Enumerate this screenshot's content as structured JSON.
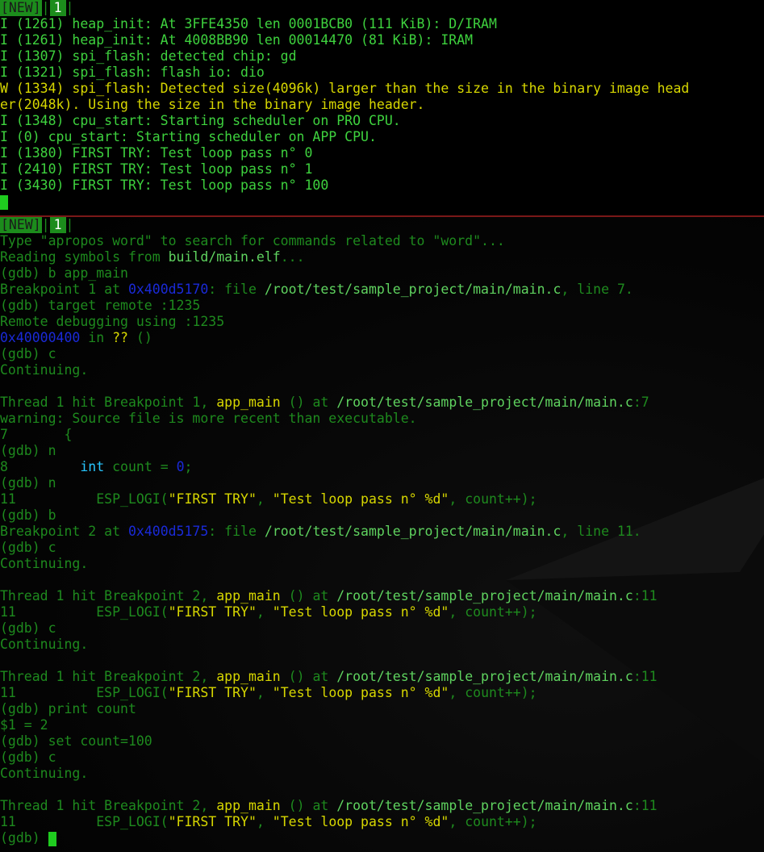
{
  "panes": [
    {
      "tabs": {
        "new_label": "[NEW]",
        "sep1": "|",
        "num_label": "1",
        "sep2": "|"
      },
      "lines": [
        [
          {
            "t": "I (1261) heap_init: At 3FFE4350 len 0001BCB0 (111 KiB): D/IRAM",
            "c": "c-g"
          }
        ],
        [
          {
            "t": "I (1261) heap_init: At 4008BB90 len 00014470 (81 KiB): IRAM",
            "c": "c-g"
          }
        ],
        [
          {
            "t": "I (1307) spi_flash: detected chip: gd",
            "c": "c-g"
          }
        ],
        [
          {
            "t": "I (1321) spi_flash: flash io: dio",
            "c": "c-g"
          }
        ],
        [
          {
            "t": "W (1334) spi_flash: Detected size(4096k) larger than the size in the binary image head",
            "c": "c-y"
          }
        ],
        [
          {
            "t": "er(2048k). Using the size in the binary image header.",
            "c": "c-y"
          }
        ],
        [
          {
            "t": "I (1348) cpu_start: Starting scheduler on PRO CPU.",
            "c": "c-g"
          }
        ],
        [
          {
            "t": "I (0) cpu_start: Starting scheduler on APP CPU.",
            "c": "c-g"
          }
        ],
        [
          {
            "t": "I (1380) FIRST TRY: Test loop pass n° 0",
            "c": "c-g"
          }
        ],
        [
          {
            "t": "I (2410) FIRST TRY: Test loop pass n° 1",
            "c": "c-g"
          }
        ],
        [
          {
            "t": "I (3430) FIRST TRY: Test loop pass n° 100",
            "c": "c-g"
          }
        ],
        [
          {
            "cursor": true
          }
        ]
      ]
    },
    {
      "tabs": {
        "new_label": "[NEW]",
        "sep1": "|",
        "num_label": "1",
        "sep2": "|"
      },
      "lines": [
        [
          {
            "t": "Type \"apropos word\" to search for commands related to \"word\"...",
            "c": "c-dg"
          }
        ],
        [
          {
            "t": "Reading symbols from ",
            "c": "c-dg"
          },
          {
            "t": "build/main.elf",
            "c": "c-ok"
          },
          {
            "t": "...",
            "c": "c-dg"
          }
        ],
        [
          {
            "t": "(gdb) b app_main",
            "c": "c-dg"
          }
        ],
        [
          {
            "t": "Breakpoint 1 at ",
            "c": "c-dg"
          },
          {
            "t": "0x400d5170",
            "c": "c-b"
          },
          {
            "t": ": file ",
            "c": "c-dg"
          },
          {
            "t": "/root/test/sample_project/main/main.c",
            "c": "c-ok"
          },
          {
            "t": ", line 7.",
            "c": "c-dg"
          }
        ],
        [
          {
            "t": "(gdb) target remote :1235",
            "c": "c-dg"
          }
        ],
        [
          {
            "t": "Remote debugging using :1235",
            "c": "c-dg"
          }
        ],
        [
          {
            "t": "0x40000400",
            "c": "c-b"
          },
          {
            "t": " in ",
            "c": "c-dg"
          },
          {
            "t": "??",
            "c": "c-y"
          },
          {
            "t": " ()",
            "c": "c-dg"
          }
        ],
        [
          {
            "t": "(gdb) c",
            "c": "c-dg"
          }
        ],
        [
          {
            "t": "Continuing.",
            "c": "c-dg"
          }
        ],
        [
          {
            "t": "",
            "c": "c-dg"
          }
        ],
        [
          {
            "t": "Thread 1 hit Breakpoint 1, ",
            "c": "c-dg"
          },
          {
            "t": "app_main",
            "c": "c-y"
          },
          {
            "t": " () at ",
            "c": "c-dg"
          },
          {
            "t": "/root/test/sample_project/main/main.c",
            "c": "c-ok"
          },
          {
            "t": ":7",
            "c": "c-dg"
          }
        ],
        [
          {
            "t": "warning: Source file is more recent than executable.",
            "c": "c-dg"
          }
        ],
        [
          {
            "t": "7       {",
            "c": "c-dg"
          }
        ],
        [
          {
            "t": "(gdb) n",
            "c": "c-dg"
          }
        ],
        [
          {
            "t": "8         ",
            "c": "c-dg"
          },
          {
            "t": "int",
            "c": "c-c"
          },
          {
            "t": " count = ",
            "c": "c-dg"
          },
          {
            "t": "0",
            "c": "c-b"
          },
          {
            "t": ";",
            "c": "c-dg"
          }
        ],
        [
          {
            "t": "(gdb) n",
            "c": "c-dg"
          }
        ],
        [
          {
            "t": "11          ESP_LOGI(",
            "c": "c-dg"
          },
          {
            "t": "\"FIRST TRY\"",
            "c": "c-y"
          },
          {
            "t": ", ",
            "c": "c-dg"
          },
          {
            "t": "\"Test loop pass n° %d\"",
            "c": "c-y"
          },
          {
            "t": ", count++);",
            "c": "c-dg"
          }
        ],
        [
          {
            "t": "(gdb) b",
            "c": "c-dg"
          }
        ],
        [
          {
            "t": "Breakpoint 2 at ",
            "c": "c-dg"
          },
          {
            "t": "0x400d5175",
            "c": "c-b"
          },
          {
            "t": ": file ",
            "c": "c-dg"
          },
          {
            "t": "/root/test/sample_project/main/main.c",
            "c": "c-ok"
          },
          {
            "t": ", line 11.",
            "c": "c-dg"
          }
        ],
        [
          {
            "t": "(gdb) c",
            "c": "c-dg"
          }
        ],
        [
          {
            "t": "Continuing.",
            "c": "c-dg"
          }
        ],
        [
          {
            "t": "",
            "c": "c-dg"
          }
        ],
        [
          {
            "t": "Thread 1 hit Breakpoint 2, ",
            "c": "c-dg"
          },
          {
            "t": "app_main",
            "c": "c-y"
          },
          {
            "t": " () at ",
            "c": "c-dg"
          },
          {
            "t": "/root/test/sample_project/main/main.c",
            "c": "c-ok"
          },
          {
            "t": ":11",
            "c": "c-dg"
          }
        ],
        [
          {
            "t": "11          ESP_LOGI(",
            "c": "c-dg"
          },
          {
            "t": "\"FIRST TRY\"",
            "c": "c-y"
          },
          {
            "t": ", ",
            "c": "c-dg"
          },
          {
            "t": "\"Test loop pass n° %d\"",
            "c": "c-y"
          },
          {
            "t": ", count++);",
            "c": "c-dg"
          }
        ],
        [
          {
            "t": "(gdb) c",
            "c": "c-dg"
          }
        ],
        [
          {
            "t": "Continuing.",
            "c": "c-dg"
          }
        ],
        [
          {
            "t": "",
            "c": "c-dg"
          }
        ],
        [
          {
            "t": "Thread 1 hit Breakpoint 2, ",
            "c": "c-dg"
          },
          {
            "t": "app_main",
            "c": "c-y"
          },
          {
            "t": " () at ",
            "c": "c-dg"
          },
          {
            "t": "/root/test/sample_project/main/main.c",
            "c": "c-ok"
          },
          {
            "t": ":11",
            "c": "c-dg"
          }
        ],
        [
          {
            "t": "11          ESP_LOGI(",
            "c": "c-dg"
          },
          {
            "t": "\"FIRST TRY\"",
            "c": "c-y"
          },
          {
            "t": ", ",
            "c": "c-dg"
          },
          {
            "t": "\"Test loop pass n° %d\"",
            "c": "c-y"
          },
          {
            "t": ", count++);",
            "c": "c-dg"
          }
        ],
        [
          {
            "t": "(gdb) print count",
            "c": "c-dg"
          }
        ],
        [
          {
            "t": "$1 = 2",
            "c": "c-dg"
          }
        ],
        [
          {
            "t": "(gdb) set count=100",
            "c": "c-dg"
          }
        ],
        [
          {
            "t": "(gdb) c",
            "c": "c-dg"
          }
        ],
        [
          {
            "t": "Continuing.",
            "c": "c-dg"
          }
        ],
        [
          {
            "t": "",
            "c": "c-dg"
          }
        ],
        [
          {
            "t": "Thread 1 hit Breakpoint 2, ",
            "c": "c-dg"
          },
          {
            "t": "app_main",
            "c": "c-y"
          },
          {
            "t": " () at ",
            "c": "c-dg"
          },
          {
            "t": "/root/test/sample_project/main/main.c",
            "c": "c-ok"
          },
          {
            "t": ":11",
            "c": "c-dg"
          }
        ],
        [
          {
            "t": "11          ESP_LOGI(",
            "c": "c-dg"
          },
          {
            "t": "\"FIRST TRY\"",
            "c": "c-y"
          },
          {
            "t": ", ",
            "c": "c-dg"
          },
          {
            "t": "\"Test loop pass n° %d\"",
            "c": "c-y"
          },
          {
            "t": ", count++);",
            "c": "c-dg"
          }
        ],
        [
          {
            "t": "(gdb) ",
            "c": "c-dg"
          },
          {
            "cursor": true
          }
        ]
      ]
    }
  ],
  "colors": {
    "tab_green": "#1c8c1c",
    "log_green": "#3ed23e",
    "warn_yellow": "#d7d700",
    "gdb_green": "#1e8a1e",
    "address_blue": "#1a2ad8",
    "keyword_cyan": "#27c6ff",
    "pane_divider": "#7a1818"
  }
}
